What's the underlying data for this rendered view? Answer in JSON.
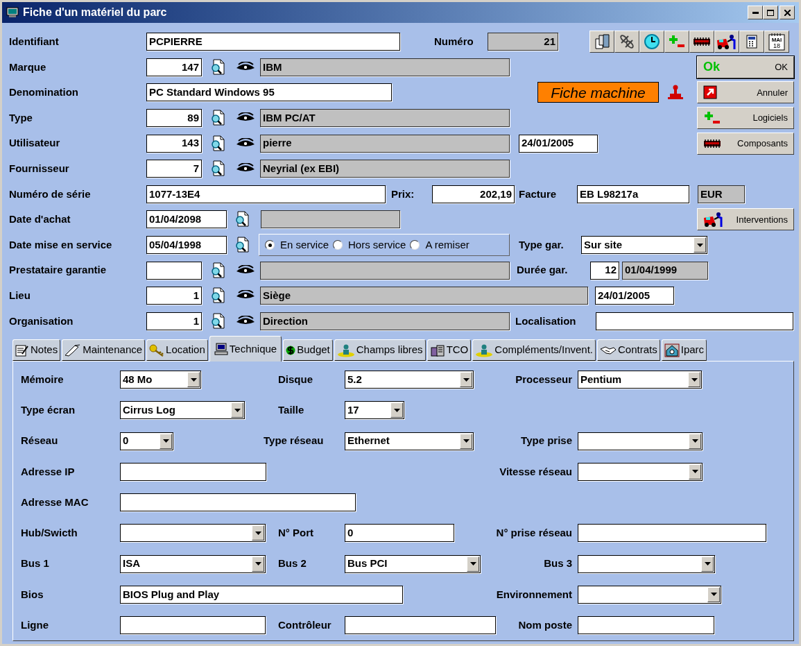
{
  "window": {
    "title": "Fiche d'un matériel du parc"
  },
  "identifiant": {
    "label": "Identifiant",
    "value": "PCPIERRE"
  },
  "numero": {
    "label": "Numéro",
    "value": "21"
  },
  "toolbar_calendar": {
    "month": "MAI",
    "day": "18"
  },
  "marque": {
    "label": "Marque",
    "code": "147",
    "name": "IBM"
  },
  "denomination": {
    "label": "Denomination",
    "value": "PC Standard Windows 95"
  },
  "record_badge": "Fiche machine",
  "type": {
    "label": "Type",
    "code": "89",
    "name": "IBM PC/AT"
  },
  "utilisateur": {
    "label": "Utilisateur",
    "code": "143",
    "name": "pierre",
    "date": "24/01/2005"
  },
  "fournisseur": {
    "label": "Fournisseur",
    "code": "7",
    "name": "Neyrial (ex EBI)"
  },
  "numero_serie": {
    "label": "Numéro de série",
    "value": "1077-13E4"
  },
  "prix": {
    "label": "Prix:",
    "value": "202,19"
  },
  "facture": {
    "label": "Facture",
    "value": "EB L98217a"
  },
  "currency": "EUR",
  "date_achat": {
    "label": "Date d'achat",
    "value": "01/04/2098"
  },
  "date_service": {
    "label": "Date mise en service",
    "value": "05/04/1998"
  },
  "status_options": [
    {
      "label": "En service",
      "selected": true
    },
    {
      "label": "Hors service",
      "selected": false
    },
    {
      "label": "A remiser",
      "selected": false
    }
  ],
  "type_garantie": {
    "label": "Type gar.",
    "value": "Sur site"
  },
  "prestataire": {
    "label": "Prestataire garantie"
  },
  "duree_garantie": {
    "label": "Durée gar.",
    "months": "12",
    "end_date": "01/04/1999"
  },
  "lieu": {
    "label": "Lieu",
    "code": "1",
    "name": "Siège",
    "date": "24/01/2005"
  },
  "organisation": {
    "label": "Organisation",
    "code": "1",
    "name": "Direction"
  },
  "localisation": {
    "label": "Localisation"
  },
  "buttons": [
    {
      "kind": "ok",
      "mark": "Ok",
      "label": "OK"
    },
    {
      "kind": "cancel",
      "label": "Annuler"
    },
    {
      "kind": "software",
      "label": "Logiciels"
    },
    {
      "kind": "components",
      "label": "Composants"
    },
    {
      "kind": "interventions",
      "label": "Interventions"
    }
  ],
  "tabs": [
    {
      "label": "Notes",
      "selected": false
    },
    {
      "label": "Maintenance",
      "selected": false
    },
    {
      "label": "Location",
      "selected": false
    },
    {
      "label": "Technique",
      "selected": true
    },
    {
      "label": "Budget",
      "selected": false
    },
    {
      "label": "Champs libres",
      "selected": false
    },
    {
      "label": "TCO",
      "selected": false
    },
    {
      "label": "Compléments/Invent.",
      "selected": false
    },
    {
      "label": "Contrats",
      "selected": false
    },
    {
      "label": "Iparc",
      "selected": false
    }
  ],
  "technique": [
    {
      "left": {
        "kind": "select",
        "label": "Mémoire",
        "value": "48 Mo"
      },
      "middle": {
        "kind": "select",
        "label": "Disque",
        "value": "5.2"
      },
      "right": {
        "kind": "select",
        "label": "Processeur",
        "value": "Pentium"
      }
    },
    {
      "left": {
        "kind": "select",
        "label": "Type écran",
        "value": "Cirrus Log"
      },
      "middle": {
        "kind": "select",
        "label": "Taille",
        "value": "17"
      }
    },
    {
      "left": {
        "kind": "select",
        "label": "Réseau",
        "value": "0"
      },
      "middle": {
        "kind": "select",
        "label": "Type réseau",
        "value": "Ethernet"
      },
      "right": {
        "kind": "select",
        "label": "Type prise"
      }
    },
    {
      "left": {
        "kind": "text",
        "label": "Adresse IP"
      },
      "right": {
        "kind": "select",
        "label": "Vitesse réseau"
      }
    },
    {
      "left": {
        "kind": "text",
        "label": "Adresse MAC"
      }
    },
    {
      "left": {
        "kind": "select",
        "label": "Hub/Swicth"
      },
      "middle": {
        "kind": "text",
        "label": "N° Port",
        "value": "0"
      },
      "right": {
        "kind": "text",
        "label": "N° prise réseau"
      }
    },
    {
      "left": {
        "kind": "select",
        "label": "Bus 1",
        "value": "ISA"
      },
      "middle": {
        "kind": "select",
        "label": "Bus 2",
        "value": "Bus PCI"
      },
      "right": {
        "kind": "select",
        "label": "Bus 3"
      }
    },
    {
      "left": {
        "kind": "text",
        "label": "Bios",
        "value": "BIOS Plug and Play"
      },
      "right": {
        "kind": "select",
        "label": "Environnement"
      }
    },
    {
      "left": {
        "kind": "text",
        "label": "Ligne"
      },
      "middle": {
        "kind": "text",
        "label": "Contrôleur"
      },
      "right": {
        "kind": "text",
        "label": "Nom poste"
      }
    }
  ]
}
